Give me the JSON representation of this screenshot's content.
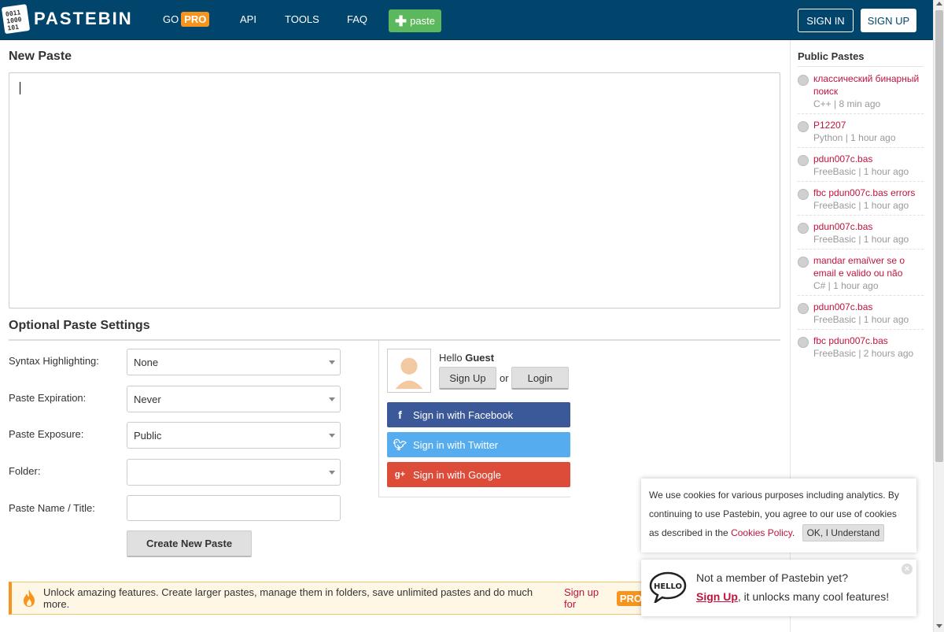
{
  "header": {
    "brand": "PASTEBIN",
    "go_label": "GO",
    "pro_badge": "PRO",
    "nav": [
      "API",
      "TOOLS",
      "FAQ"
    ],
    "paste_label": "paste",
    "signin_label": "SIGN IN",
    "signup_label": "SIGN UP",
    "bg_color": "#02456c"
  },
  "main": {
    "title": "New Paste",
    "settings_title": "Optional Paste Settings",
    "fields": {
      "syntax": {
        "label": "Syntax Highlighting:",
        "value": "None"
      },
      "expiration": {
        "label": "Paste Expiration:",
        "value": "Never"
      },
      "exposure": {
        "label": "Paste Exposure:",
        "value": "Public"
      },
      "folder": {
        "label": "Folder:",
        "value": ""
      },
      "name": {
        "label": "Paste Name / Title:",
        "value": ""
      }
    },
    "create_label": "Create New Paste"
  },
  "guest": {
    "hello": "Hello",
    "name": "Guest",
    "signup_label": "Sign Up",
    "or": "or",
    "login_label": "Login",
    "facebook": "Sign in with Facebook",
    "twitter": "Sign in with Twitter",
    "google": "Sign in with Google"
  },
  "promo": {
    "text": "Unlock amazing features. Create larger pastes, manage them in folders, save unlimited pastes and do much more.",
    "link": "Sign up for",
    "badge": "PRO"
  },
  "sidebar": {
    "title": "Public Pastes",
    "items": [
      {
        "title": "классический бинарный поиск",
        "meta": "C++ | 8 min ago"
      },
      {
        "title": "P12207",
        "meta": "Python | 1 hour ago"
      },
      {
        "title": "pdun007c.bas",
        "meta": "FreeBasic | 1 hour ago"
      },
      {
        "title": "fbc pdun007c.bas errors",
        "meta": "FreeBasic | 1 hour ago"
      },
      {
        "title": "pdun007c.bas",
        "meta": "FreeBasic | 1 hour ago"
      },
      {
        "title": "mandar emai\\ver se o email e valido ou não",
        "meta": "C# | 1 hour ago"
      },
      {
        "title": "pdun007c.bas",
        "meta": "FreeBasic | 1 hour ago"
      },
      {
        "title": "fbc pdun007c.bas",
        "meta": "FreeBasic | 2 hours ago"
      }
    ]
  },
  "cookie": {
    "text": "We use cookies for various purposes including analytics. By continuing to use Pastebin, you agree to our use of cookies as described in the",
    "link": "Cookies Policy",
    "after": ".",
    "ok_label": "OK, I Understand"
  },
  "member": {
    "line1": "Not a member of Pastebin yet?",
    "link": "Sign Up",
    "line2": ", it unlocks many cool features!"
  }
}
